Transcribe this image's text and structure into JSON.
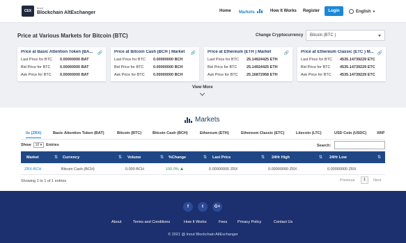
{
  "header": {
    "logo_text": "CEX",
    "brand_small": "Inout",
    "brand_big": "Blockchain AltExchanger",
    "nav": [
      "Home",
      "Markets",
      "How It Works",
      "Register"
    ],
    "login": "Login",
    "language": "English",
    "accent": "#1a88d8"
  },
  "prices": {
    "title": "Price at Various Markets for Bitcoin (BTC)",
    "change_label": "Change Cryptocurrency",
    "selected": "Bitcoin (BTC )",
    "cards": [
      {
        "title": "Price at Basic Attention Token (BA...",
        "rows": [
          {
            "label": "Last Price for BTC",
            "value": "0.00000000 BAT"
          },
          {
            "label": "Bid Price for BTC",
            "value": "0.00000000 BAT"
          },
          {
            "label": "Ask Price for BTC",
            "value": "0.00000000 BAT"
          }
        ]
      },
      {
        "title": "Price at Bitcoin Cash (BCH ) Market",
        "rows": [
          {
            "label": "Last Price for BTC",
            "value": "0.00000000 BCH"
          },
          {
            "label": "Bid Price for BTC",
            "value": "0.00000000 BCH"
          },
          {
            "label": "Ask Price for BTC",
            "value": "0.00000000 BCH"
          }
        ]
      },
      {
        "title": "Price at Ethereum (ETH ) Market",
        "rows": [
          {
            "label": "Last Price for BTC",
            "value": "25.14924425 ETH"
          },
          {
            "label": "Bid Price for BTC",
            "value": "25.14924425 ETH"
          },
          {
            "label": "Ask Price for BTC",
            "value": "25.16872958 ETH"
          }
        ]
      },
      {
        "title": "Price at Ethereum Classic (ETC ) M...",
        "rows": [
          {
            "label": "Last Price for BTC",
            "value": "4535.14739229 ETC"
          },
          {
            "label": "Bid Price for BTC",
            "value": "4535.14739229 ETC"
          },
          {
            "label": "Ask Price for BTC",
            "value": "4535.14739229 ETC"
          }
        ]
      }
    ],
    "view_more": "View More"
  },
  "markets": {
    "title": "Markets",
    "tabs": [
      "0x (ZRX)",
      "Basic Attention Token (BAT)",
      "Bitcoin (BTC)",
      "Bitcoin Cash (BCH)",
      "Ethereum (ETH)",
      "Ethereum Classic (ETC)",
      "Litecoin (LTC)",
      "USD Coin (USDC)",
      "XRP"
    ],
    "show": "Show",
    "show_value": "10",
    "entries": "Entries",
    "search": "Search:",
    "columns": [
      "Market",
      "Currency",
      "Volume",
      "%Change",
      "Last Price",
      "24Hr High",
      "24Hr Low"
    ],
    "rows": [
      [
        "ZRX-BCH",
        "Bitcoin Cash (BCH)",
        "0.000 BCH",
        "100.0%",
        "0.00000000 ZRX",
        "0.00000000 ZRX",
        "0.00000000 ZRX"
      ]
    ],
    "info": "Showing 1 to 1 of 1 entries",
    "previous": "Previous",
    "page": "1",
    "next": "Next"
  },
  "footer": {
    "social": [
      "f",
      "t",
      "G+"
    ],
    "links": [
      "About",
      "Terms and Conditions",
      "How It Works",
      "Fees",
      "Privacy Policy",
      "Contact Us"
    ],
    "copyright": "© 2021 @ Inout Blockchain AltExchanger"
  }
}
